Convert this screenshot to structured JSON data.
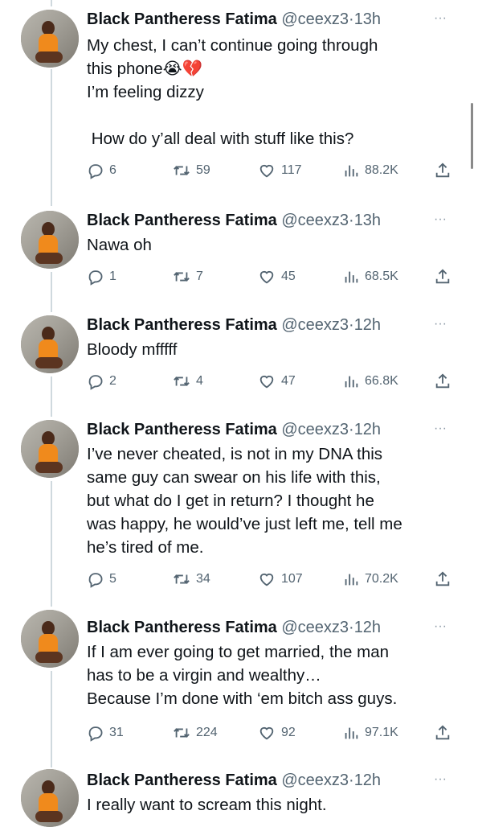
{
  "author": {
    "name": "Black Pantheress Fatima",
    "handle": "@ceexz3",
    "separator": "·"
  },
  "more_icon": "···",
  "icons": {
    "reply": "reply-icon",
    "retweet": "retweet-icon",
    "like": "heart-icon",
    "views": "views-icon",
    "share": "share-icon"
  },
  "colors": {
    "text": "#0f1419",
    "muted": "#536471",
    "thread_line": "#cfd9de"
  },
  "tweets": [
    {
      "time": "13h",
      "text": "My chest, I can’t continue going through\nthis phone😭💔\nI’m feeling dizzy\n\n How do y’all deal with stuff like this?",
      "replies": "6",
      "retweets": "59",
      "likes": "117",
      "views": "88.2K"
    },
    {
      "time": "13h",
      "text": "Nawa oh",
      "replies": "1",
      "retweets": "7",
      "likes": "45",
      "views": "68.5K"
    },
    {
      "time": "12h",
      "text": "Bloody mfffff",
      "replies": "2",
      "retweets": "4",
      "likes": "47",
      "views": "66.8K"
    },
    {
      "time": "12h",
      "text": "I’ve never cheated, is not in my DNA this\nsame guy can swear on his life with this,\nbut what do I get in return? I thought he\nwas happy, he would’ve just left me, tell me\nhe’s tired of me.",
      "replies": "5",
      "retweets": "34",
      "likes": "107",
      "views": "70.2K"
    },
    {
      "time": "12h",
      "text": "If I am ever going to get married, the man\nhas to be a virgin and wealthy…\nBecause I’m done with ‘em bitch ass guys.",
      "replies": "31",
      "retweets": "224",
      "likes": "92",
      "views": "97.1K"
    },
    {
      "time": "12h",
      "text": "I really want to scream this night."
    }
  ]
}
